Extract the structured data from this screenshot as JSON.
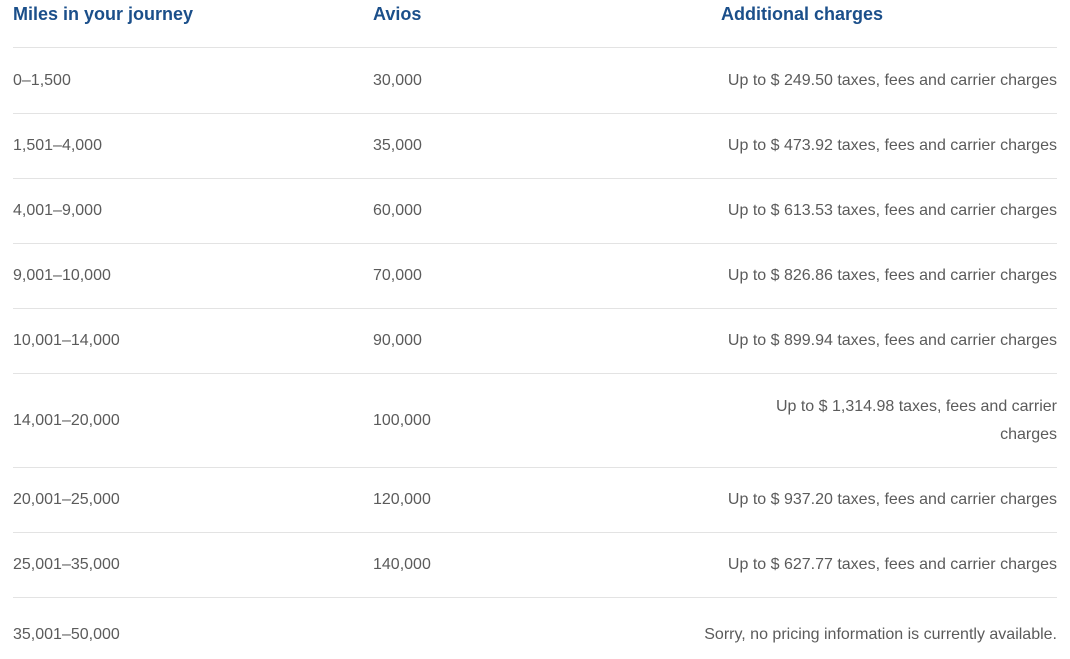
{
  "headers": {
    "miles": "Miles in your journey",
    "avios": "Avios",
    "charges": "Additional charges"
  },
  "rows": [
    {
      "miles": "0–1,500",
      "avios": "30,000",
      "charges": "Up to $ 249.50 taxes, fees and carrier charges"
    },
    {
      "miles": "1,501–4,000",
      "avios": "35,000",
      "charges": "Up to $ 473.92 taxes, fees and carrier charges"
    },
    {
      "miles": "4,001–9,000",
      "avios": "60,000",
      "charges": "Up to $ 613.53 taxes, fees and carrier charges"
    },
    {
      "miles": "9,001–10,000",
      "avios": "70,000",
      "charges": "Up to $ 826.86 taxes, fees and carrier charges"
    },
    {
      "miles": "10,001–14,000",
      "avios": "90,000",
      "charges": "Up to $ 899.94 taxes, fees and carrier charges"
    },
    {
      "miles": "14,001–20,000",
      "avios": "100,000",
      "charges": "Up to $ 1,314.98 taxes, fees and carrier charges"
    },
    {
      "miles": "20,001–25,000",
      "avios": "120,000",
      "charges": "Up to $ 937.20 taxes, fees and carrier charges"
    },
    {
      "miles": "25,001–35,000",
      "avios": "140,000",
      "charges": "Up to $ 627.77 taxes, fees and carrier charges"
    },
    {
      "miles": "35,001–50,000",
      "avios": "",
      "charges": "Sorry, no pricing information is currently available."
    }
  ],
  "colors": {
    "header_text": "#1b4f8a",
    "body_text": "#5b5b5b",
    "divider": "#e3e3e3"
  }
}
